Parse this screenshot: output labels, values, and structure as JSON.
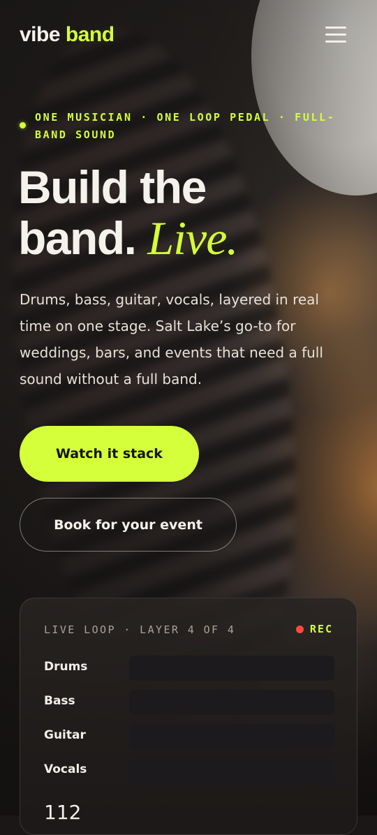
{
  "brand": {
    "word1": "vibe",
    "word2": "band"
  },
  "menu_icon": "hamburger-icon",
  "hero": {
    "eyebrow": "ONE MUSICIAN · ONE LOOP PEDAL · FULL-BAND SOUND",
    "headline_line1": "Build the",
    "headline_line2_plain": "band.",
    "headline_line2_accent": "Live.",
    "description": "Drums, bass, guitar, vocals, layered in real time on one stage. Salt Lake’s go-to for weddings, bars, and events that need a full sound without a full band.",
    "primary_cta": "Watch it stack",
    "secondary_cta": "Book for your event"
  },
  "loop_card": {
    "title": "LIVE LOOP · LAYER 4 OF 4",
    "status": "REC",
    "layers": [
      {
        "label": "Drums"
      },
      {
        "label": "Bass"
      },
      {
        "label": "Guitar"
      },
      {
        "label": "Vocals"
      }
    ],
    "bpm": "112"
  },
  "colors": {
    "accent": "#d4ff3a",
    "background": "#1a1716",
    "text": "#f3efe8",
    "rec_dot": "#ff4a3d"
  }
}
